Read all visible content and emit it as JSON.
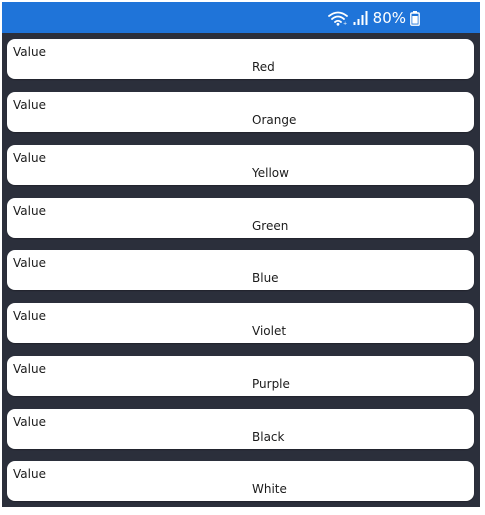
{
  "status_bar": {
    "battery_text": "80%",
    "icons": [
      "wifi-icon",
      "signal-icon",
      "battery-icon"
    ],
    "background_color": "#1f74d9"
  },
  "list": {
    "background_color": "#2b2f3b",
    "items": [
      {
        "label": "Value",
        "value": "Red"
      },
      {
        "label": "Value",
        "value": "Orange"
      },
      {
        "label": "Value",
        "value": "Yellow"
      },
      {
        "label": "Value",
        "value": "Green"
      },
      {
        "label": "Value",
        "value": "Blue"
      },
      {
        "label": "Value",
        "value": "Violet"
      },
      {
        "label": "Value",
        "value": "Purple"
      },
      {
        "label": "Value",
        "value": "Black"
      },
      {
        "label": "Value",
        "value": "White"
      }
    ]
  }
}
